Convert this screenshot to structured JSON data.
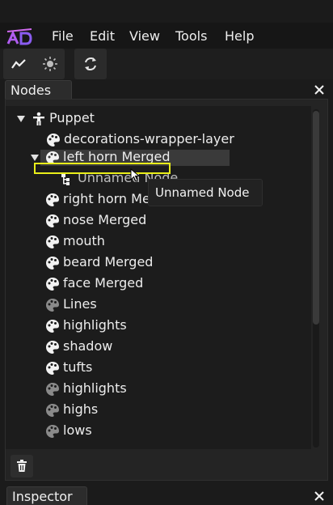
{
  "menu": {
    "file": "File",
    "edit": "Edit",
    "view": "View",
    "tools": "Tools",
    "help": "Help"
  },
  "toolbar": {
    "icons": [
      "graph-icon",
      "sun-icon",
      "refresh-icon"
    ]
  },
  "nodes_panel": {
    "tab_label": "Nodes",
    "tree": [
      {
        "label": "Puppet",
        "icon": "person-icon",
        "expanded": true
      },
      {
        "label": "decorations-wrapper-layer",
        "icon": "palette-icon"
      },
      {
        "label": "left horn Merged",
        "icon": "palette-icon",
        "expanded": true,
        "selected": true
      },
      {
        "label": "Unnamed Node",
        "icon": "node-icon"
      },
      {
        "label": "right horn Merged",
        "icon": "palette-icon"
      },
      {
        "label": "nose Merged",
        "icon": "palette-icon"
      },
      {
        "label": "mouth",
        "icon": "palette-icon"
      },
      {
        "label": "beard Merged",
        "icon": "palette-icon"
      },
      {
        "label": "face Merged",
        "icon": "palette-icon"
      },
      {
        "label": "Lines",
        "icon": "palette-icon",
        "dimmed": true
      },
      {
        "label": "highlights",
        "icon": "palette-icon"
      },
      {
        "label": "shadow",
        "icon": "palette-icon"
      },
      {
        "label": "tufts",
        "icon": "palette-icon"
      },
      {
        "label": "highlights",
        "icon": "palette-icon",
        "dimmed": true
      },
      {
        "label": "highs",
        "icon": "palette-icon",
        "dimmed": true
      },
      {
        "label": "lows",
        "icon": "palette-icon",
        "dimmed": true
      }
    ],
    "tooltip": "Unnamed Node"
  },
  "inspector": {
    "tab_label": "Inspector"
  },
  "colors": {
    "accent_drop_indicator": "#e9ee1a",
    "logo": "#b05cf0"
  }
}
